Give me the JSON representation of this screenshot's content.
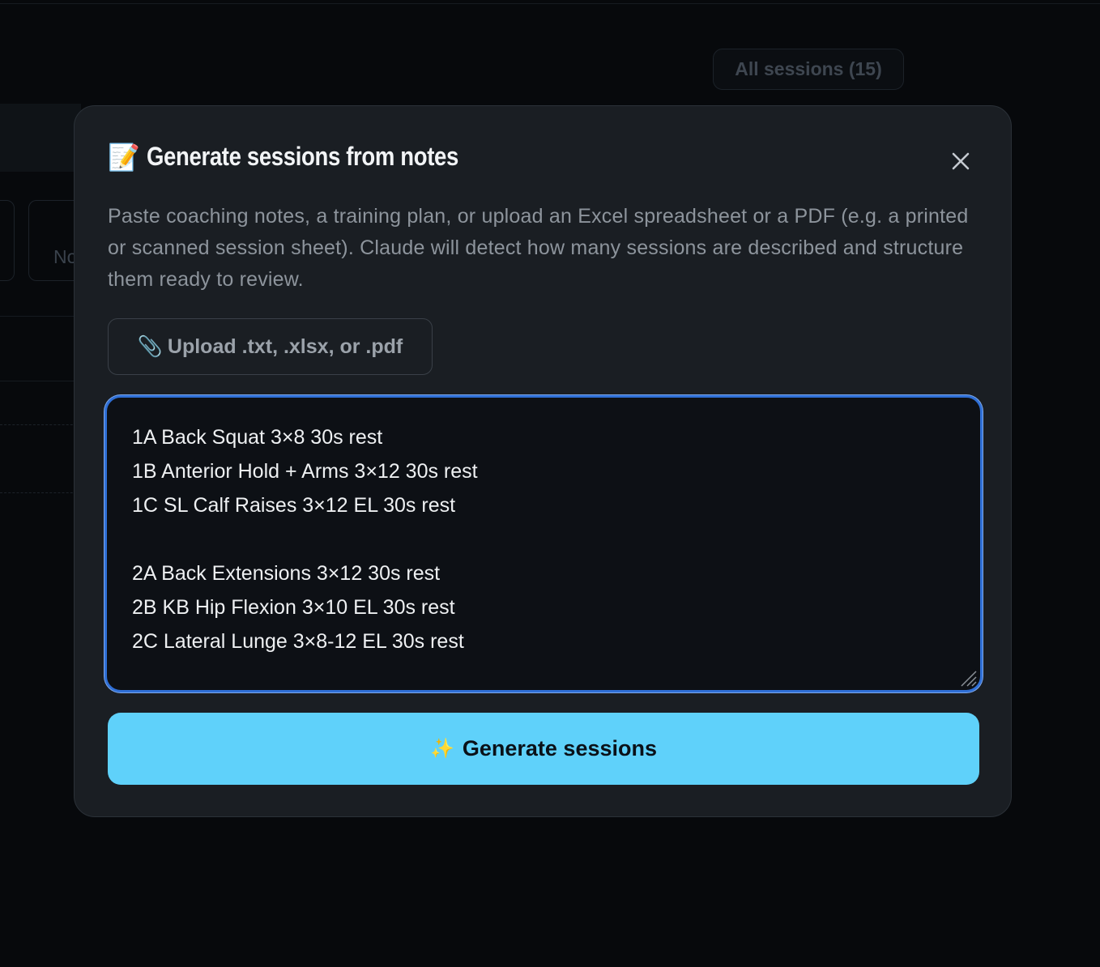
{
  "background": {
    "sessions_pill": "All sessions (15)",
    "card_fragment": "No"
  },
  "modal": {
    "title_icon": "📝",
    "title": "Generate sessions from notes",
    "close_icon": "close-icon",
    "description": "Paste coaching notes, a training plan, or upload an Excel spreadsheet or a PDF (e.g. a printed or scanned session sheet). Claude will detect how many sessions are described and structure them ready to review.",
    "upload_icon": "📎",
    "upload_label": "Upload .txt, .xlsx, or .pdf",
    "notes_value": "1A Back Squat 3×8 30s rest\n1B Anterior Hold + Arms 3×12 30s rest\n1C SL Calf Raises 3×12 EL 30s rest\n\n2A Back Extensions 3×12 30s rest\n2B KB Hip Flexion 3×10 EL 30s rest\n2C Lateral Lunge 3×8-12 EL 30s rest",
    "generate_icon": "✨",
    "generate_label": "Generate sessions"
  },
  "colors": {
    "modal_bg": "#1a1e23",
    "accent": "#5fd1fa",
    "focus_ring": "#2f6fd6",
    "page_bg": "#07090c"
  }
}
